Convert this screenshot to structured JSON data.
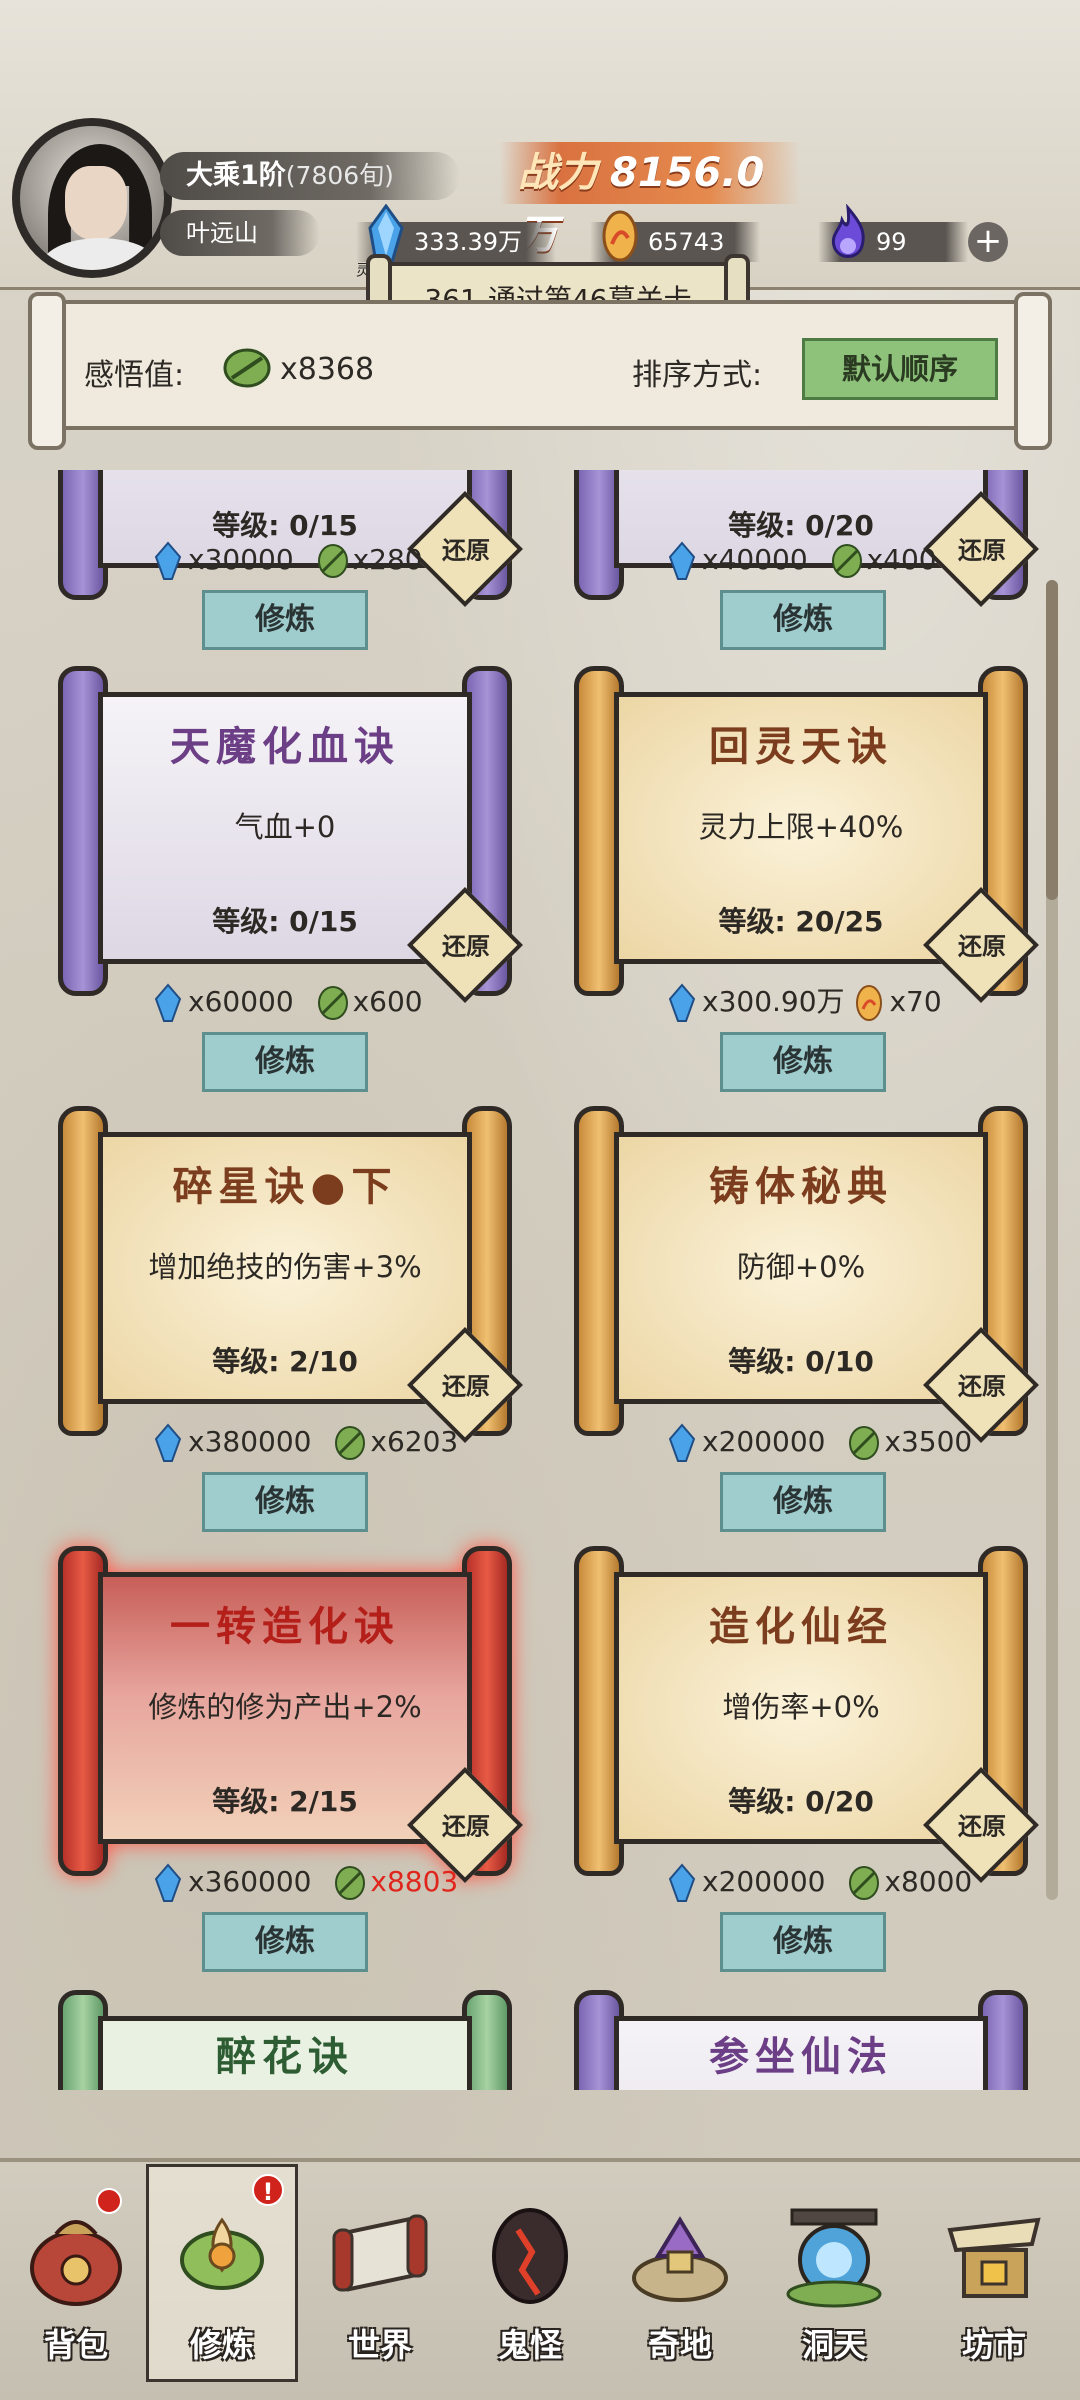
{
  "header": {
    "rank": "大乘1阶",
    "rank_sub": "(7806旬)",
    "player_name": "叶远山",
    "power_label": "战力",
    "power_value": "8156.0万",
    "resources": [
      {
        "icon": "spirit-crystal-icon",
        "caption": "灵晶",
        "value": "333.39万"
      },
      {
        "icon": "creation-stone-icon",
        "caption": "造化石",
        "value": "65743"
      },
      {
        "icon": "purple-flame-icon",
        "caption": "",
        "value": "99"
      }
    ],
    "stage_banner": "361-通过第46幕关卡"
  },
  "toolbar": {
    "insight_label": "感悟值:",
    "insight_value": "x8368",
    "sort_label": "排序方式:",
    "sort_button": "默认顺序"
  },
  "partial_top": [
    {
      "level": "等级: 0/15",
      "reset": "还原",
      "cost1": "x30000",
      "cost2": "x280",
      "button": "修炼"
    },
    {
      "level": "等级: 0/20",
      "reset": "还原",
      "cost1": "x40000",
      "cost2": "x400",
      "button": "修炼"
    }
  ],
  "cards": [
    {
      "style": "purple",
      "title": "天魔化血诀",
      "effect": "气血+0",
      "level": "等级: 0/15",
      "reset": "还原",
      "cost1": "x60000",
      "cost2": "x600",
      "cost2_icon": "leaf",
      "cost2_red": false,
      "button": "修炼"
    },
    {
      "style": "gold",
      "title": "回灵天诀",
      "effect": "灵力上限+40%",
      "level": "等级: 20/25",
      "reset": "还原",
      "cost1": "x300.90万",
      "cost2": "x70",
      "cost2_icon": "stone",
      "cost2_red": false,
      "button": "修炼"
    },
    {
      "style": "gold",
      "title": "碎星诀●下",
      "effect": "增加绝技的伤害+3%",
      "level": "等级: 2/10",
      "reset": "还原",
      "cost1": "x380000",
      "cost2": "x6203",
      "cost2_icon": "leaf",
      "cost2_red": false,
      "button": "修炼"
    },
    {
      "style": "gold",
      "title": "铸体秘典",
      "effect": "防御+0%",
      "level": "等级: 0/10",
      "reset": "还原",
      "cost1": "x200000",
      "cost2": "x3500",
      "cost2_icon": "leaf",
      "cost2_red": false,
      "button": "修炼"
    },
    {
      "style": "red",
      "title": "一转造化诀",
      "effect": "修炼的修为产出+2%",
      "level": "等级: 2/15",
      "reset": "还原",
      "cost1": "x360000",
      "cost2": "x8803",
      "cost2_icon": "leaf",
      "cost2_red": true,
      "button": "修炼"
    },
    {
      "style": "gold",
      "title": "造化仙经",
      "effect": "增伤率+0%",
      "level": "等级: 0/20",
      "reset": "还原",
      "cost1": "x200000",
      "cost2": "x8000",
      "cost2_icon": "leaf",
      "cost2_red": false,
      "button": "修炼"
    }
  ],
  "partial_bottom": [
    {
      "style": "green",
      "title": "醉花诀"
    },
    {
      "style": "purple",
      "title": "参坐仙法"
    }
  ],
  "nav": [
    {
      "label": "背包",
      "icon": "bag-icon"
    },
    {
      "label": "修炼",
      "icon": "lotus-icon"
    },
    {
      "label": "世界",
      "icon": "scroll-map-icon"
    },
    {
      "label": "鬼怪",
      "icon": "demon-egg-icon"
    },
    {
      "label": "奇地",
      "icon": "pagoda-icon"
    },
    {
      "label": "洞天",
      "icon": "portal-icon"
    },
    {
      "label": "坊市",
      "icon": "market-stall-icon"
    }
  ],
  "colors": {
    "train_button": "#9fcccd",
    "sort_button": "#8ec27b",
    "power": "#d97240",
    "warning_text": "#e0261c"
  }
}
